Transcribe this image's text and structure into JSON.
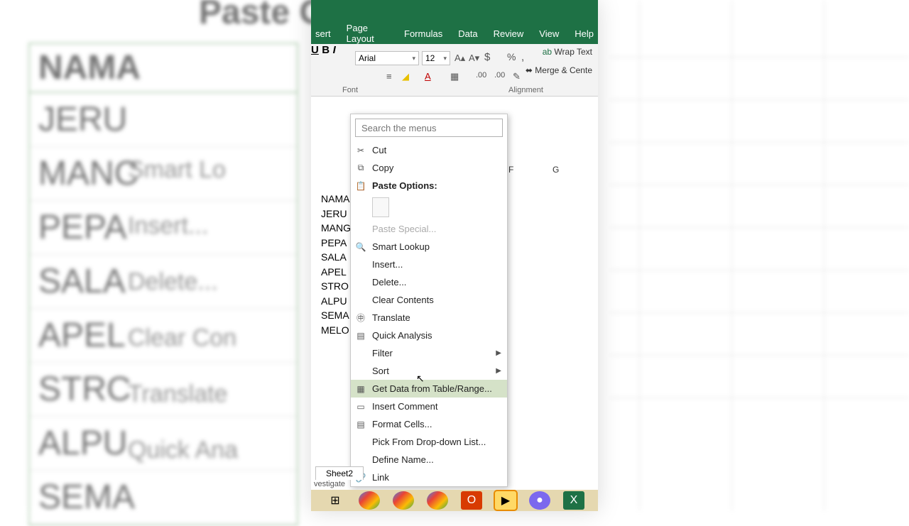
{
  "bg": {
    "title": "Paste O",
    "header": "NAMA",
    "rows": [
      "JERU",
      "MANC",
      "PEPA",
      "SALA",
      "APEL",
      "STRC",
      "ALPU",
      "SEMA"
    ],
    "menu": [
      "Smart Lo",
      "Insert...",
      "Delete...",
      "Clear Con",
      "Translate",
      "Quick Ana"
    ]
  },
  "tabs": [
    "sert",
    "Page Layout",
    "Formulas",
    "Data",
    "Review",
    "View",
    "Help"
  ],
  "ribbon": {
    "font": "Arial",
    "size": "12",
    "groupFont": "Font",
    "groupAlign": "Alignment",
    "wrap": "Wrap Text",
    "merge": "Merge & Cente"
  },
  "cols": {
    "F": "F",
    "G": "G"
  },
  "cells": {
    "header": "NAMA",
    "rows": [
      "JERU",
      "MANG",
      "PEPA",
      "SALA",
      "APEL",
      "STRO",
      "ALPU",
      "SEMA",
      "MELO"
    ]
  },
  "search_placeholder": "Search the menus",
  "ctx": {
    "cut": "Cut",
    "copy": "Copy",
    "pasteOpt": "Paste Options:",
    "pasteSpecial": "Paste Special...",
    "smart": "Smart Lookup",
    "insert": "Insert...",
    "delete": "Delete...",
    "clear": "Clear Contents",
    "translate": "Translate",
    "quick": "Quick Analysis",
    "filter": "Filter",
    "sort": "Sort",
    "getdata": "Get Data from Table/Range...",
    "comment": "Insert Comment",
    "format": "Format Cells...",
    "pick": "Pick From Drop-down List...",
    "define": "Define Name...",
    "link": "Link"
  },
  "sheet": "Sheet2",
  "status": "vestigate"
}
